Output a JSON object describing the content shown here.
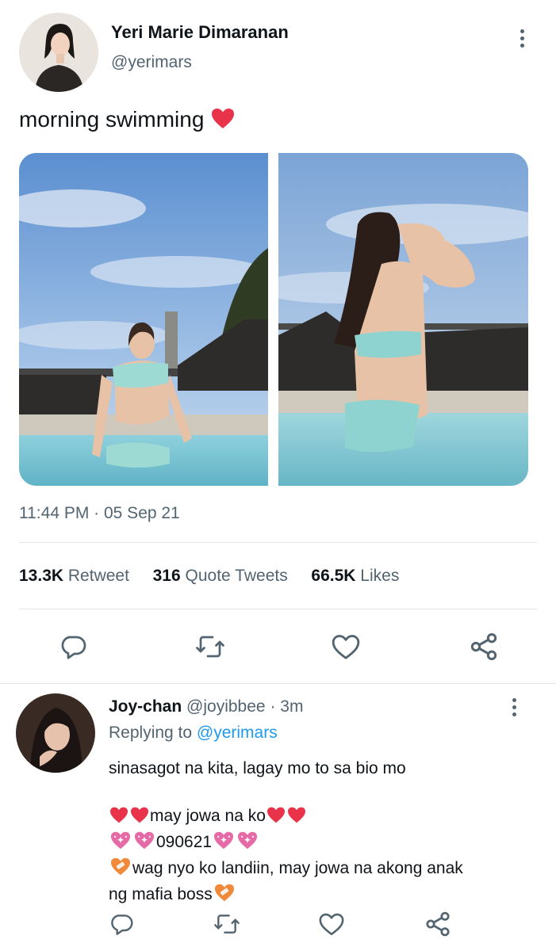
{
  "tweet": {
    "author_name": "Yeri Marie Dimaranan",
    "author_handle": "@yerimars",
    "text": "morning swimming",
    "text_emoji": "heart",
    "timestamp": "11:44 PM · 05 Sep 21",
    "stats": {
      "retweets_count": "13.3K",
      "retweets_label": "Retweet",
      "quotes_count": "316",
      "quotes_label": "Quote Tweets",
      "likes_count": "66.5K",
      "likes_label": "Likes"
    },
    "photos": [
      "photo-1",
      "photo-2"
    ]
  },
  "reply": {
    "author_name": "Joy-chan",
    "author_handle": "@joyibbee",
    "time": "· 3m",
    "replying_label": "Replying to",
    "replying_handle": "@yerimars",
    "line1": "sinasagot na kita, lagay mo to sa bio mo",
    "line2": "may jowa na ko",
    "line3": "090621",
    "line4a": "wag nyo ko landiin, may jowa na akong anak",
    "line4b": "ng mafia boss"
  },
  "icons": {
    "reply": "reply-icon",
    "retweet": "retweet-icon",
    "like": "like-icon",
    "share": "share-icon",
    "more": "more-options-icon"
  },
  "colors": {
    "heart": "#e8334a",
    "sparkle_heart": "#e56aa6",
    "mending_heart": "#f08a3a",
    "muted": "#536471",
    "link": "#1d9bf0"
  }
}
